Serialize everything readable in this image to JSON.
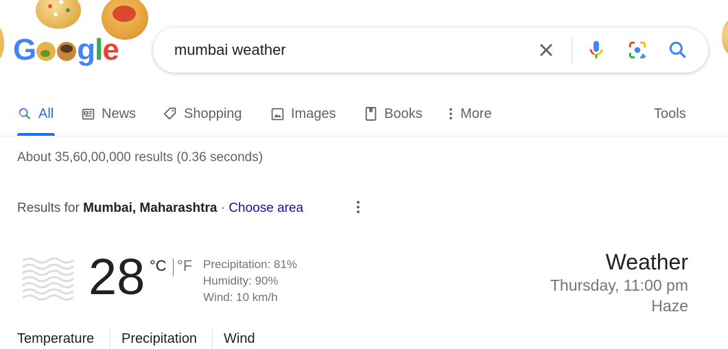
{
  "logo": {
    "text": "Google"
  },
  "search": {
    "query": "mumbai weather"
  },
  "tabs": [
    {
      "label": "All",
      "icon": "search-icon",
      "active": true
    },
    {
      "label": "News",
      "icon": "news-icon"
    },
    {
      "label": "Shopping",
      "icon": "tag-icon"
    },
    {
      "label": "Images",
      "icon": "image-icon"
    },
    {
      "label": "Books",
      "icon": "book-icon"
    },
    {
      "label": "More",
      "icon": "more-vert-icon"
    }
  ],
  "tools_label": "Tools",
  "result_stats": "About 35,60,00,000 results (0.36 seconds)",
  "location": {
    "prefix": "Results for",
    "place": "Mumbai, Maharashtra",
    "separator": "·",
    "link": "Choose area"
  },
  "weather": {
    "icon": "haze-icon",
    "temperature": "28",
    "unit_c": "°C",
    "unit_f": "°F",
    "precipitation": "Precipitation: 81%",
    "humidity": "Humidity: 90%",
    "wind": "Wind: 10 km/h",
    "title": "Weather",
    "datetime": "Thursday, 11:00 pm",
    "condition": "Haze",
    "tabs": [
      "Temperature",
      "Precipitation",
      "Wind"
    ]
  },
  "colors": {
    "blue": "#1a73e8",
    "google_blue": "#4285f4",
    "google_red": "#ea4335",
    "google_yellow": "#fbbc04",
    "google_green": "#34a853",
    "link": "#1a0dab",
    "muted": "#70757a"
  }
}
